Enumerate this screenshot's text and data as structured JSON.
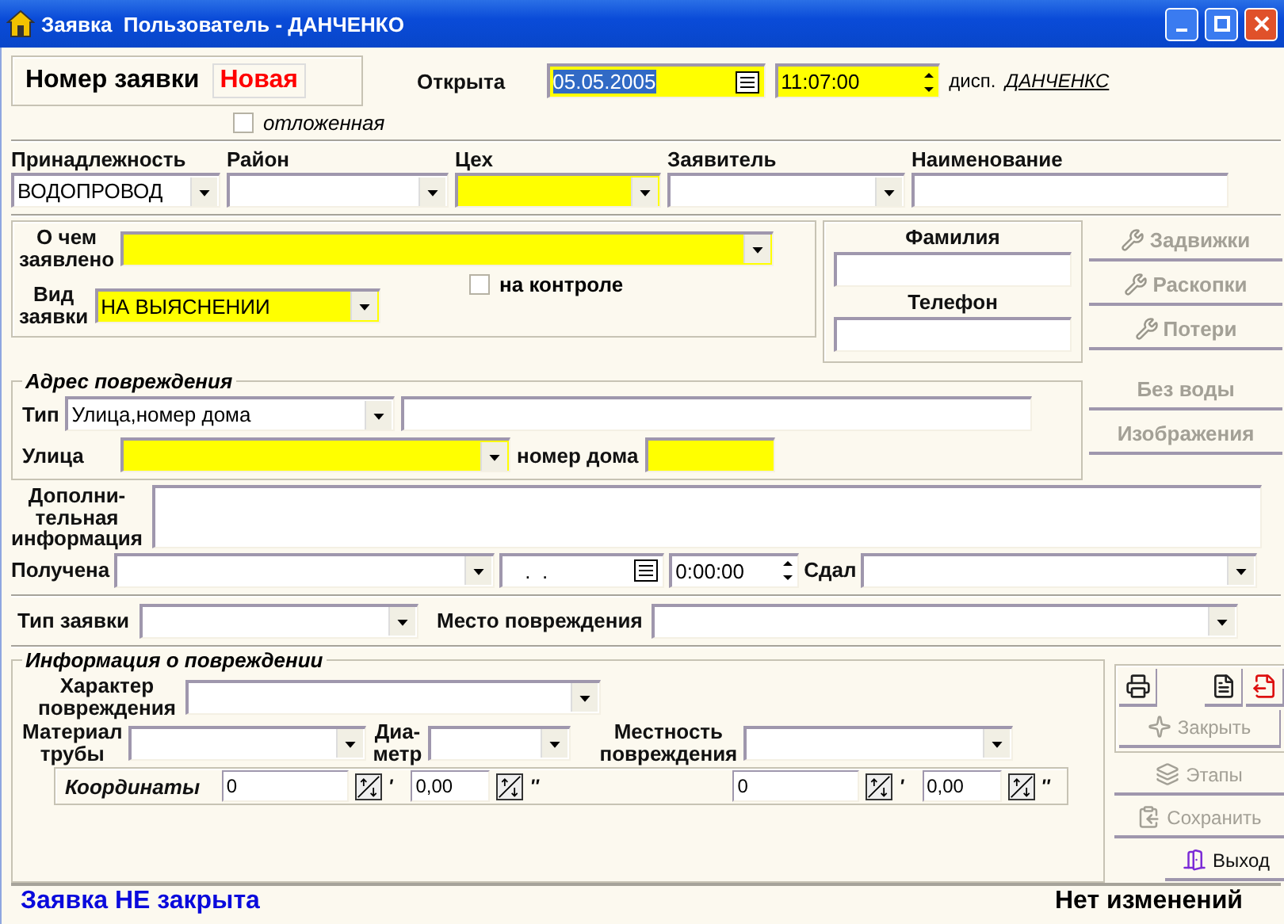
{
  "window": {
    "title": "Заявка  Пользователь - ДАНЧЕНКО"
  },
  "header": {
    "number_label": "Номер заявки",
    "number_value": "Новая",
    "opened_label": "Открыта",
    "date": "05.05.2005",
    "date_selected": true,
    "time": "11:07:00",
    "dispatcher_label": "дисп.",
    "dispatcher": "ДАНЧЕНКС",
    "deferred": {
      "label": "отложенная",
      "checked": false
    }
  },
  "top_fields": [
    {
      "label": "Принадлежность",
      "kind": "combo",
      "value": "ВОДОПРОВОД",
      "required": false
    },
    {
      "label": "Район",
      "kind": "combo",
      "required": false
    },
    {
      "label": "Цех",
      "kind": "combo",
      "required": true
    },
    {
      "label": "Заявитель",
      "kind": "combo",
      "required": false
    },
    {
      "label": "Наименование",
      "kind": "text",
      "required": false
    }
  ],
  "claim": {
    "about_label": [
      "О чем",
      "заявлено"
    ],
    "about_required": true,
    "control": {
      "label": "на контроле",
      "checked": false
    },
    "type_label": [
      "Вид",
      "заявки"
    ],
    "type_value": "НА ВЫЯСНЕНИИ",
    "type_required": true
  },
  "applicant": {
    "surname_label": "Фамилия",
    "phone_label": "Телефон"
  },
  "side_buttons": [
    {
      "label": "Задвижки",
      "kind": "icon",
      "disabled": true
    },
    {
      "label": "Раскопки",
      "kind": "icon",
      "disabled": true
    },
    {
      "label": "Потери",
      "kind": "icon",
      "disabled": true
    },
    {
      "label": "Без воды",
      "kind": "plain",
      "disabled": true
    },
    {
      "label": "Изображения",
      "kind": "plain",
      "disabled": true
    }
  ],
  "address": {
    "title": "Адрес повреждения",
    "type_label": "Тип",
    "type_value": "Улица,номер дома",
    "street_label": "Улица",
    "street_required": true,
    "house_label": "номер дома",
    "house_required": true
  },
  "extra": {
    "label": [
      "Дополни-",
      "тельная",
      "информация"
    ]
  },
  "received": {
    "label": "Получена",
    "date": ".  .",
    "time": "0:00:00",
    "handed_label": "Сдал"
  },
  "kind_row": {
    "type_label": "Тип заявки",
    "place_label": "Место повреждения"
  },
  "damage": {
    "title": "Информация о повреждении",
    "character_label": [
      "Характер",
      "повреждения"
    ],
    "material_label": [
      "Материал",
      "трубы"
    ],
    "diameter_label": [
      "Диа-",
      "метр"
    ],
    "terrain_label": [
      "Местность",
      "повреждения"
    ],
    "coords_label": "Координаты",
    "coords": [
      {
        "value": "0",
        "unit": "'"
      },
      {
        "value": "0,00",
        "unit": "''"
      },
      {
        "value": "0",
        "unit": "'"
      },
      {
        "value": "0,00",
        "unit": "''"
      }
    ]
  },
  "tool_buttons": [
    {
      "disabled": false
    },
    {
      "disabled": false
    },
    {
      "disabled": false
    }
  ],
  "actions": [
    {
      "label": "Закрыть",
      "disabled": true
    },
    {
      "label": "Этапы",
      "disabled": true
    },
    {
      "label": "Сохранить",
      "disabled": true
    },
    {
      "label": "Выход",
      "disabled": false
    }
  ],
  "status_bar": {
    "left": "Заявка НЕ закрыта",
    "right": "Нет изменений"
  }
}
